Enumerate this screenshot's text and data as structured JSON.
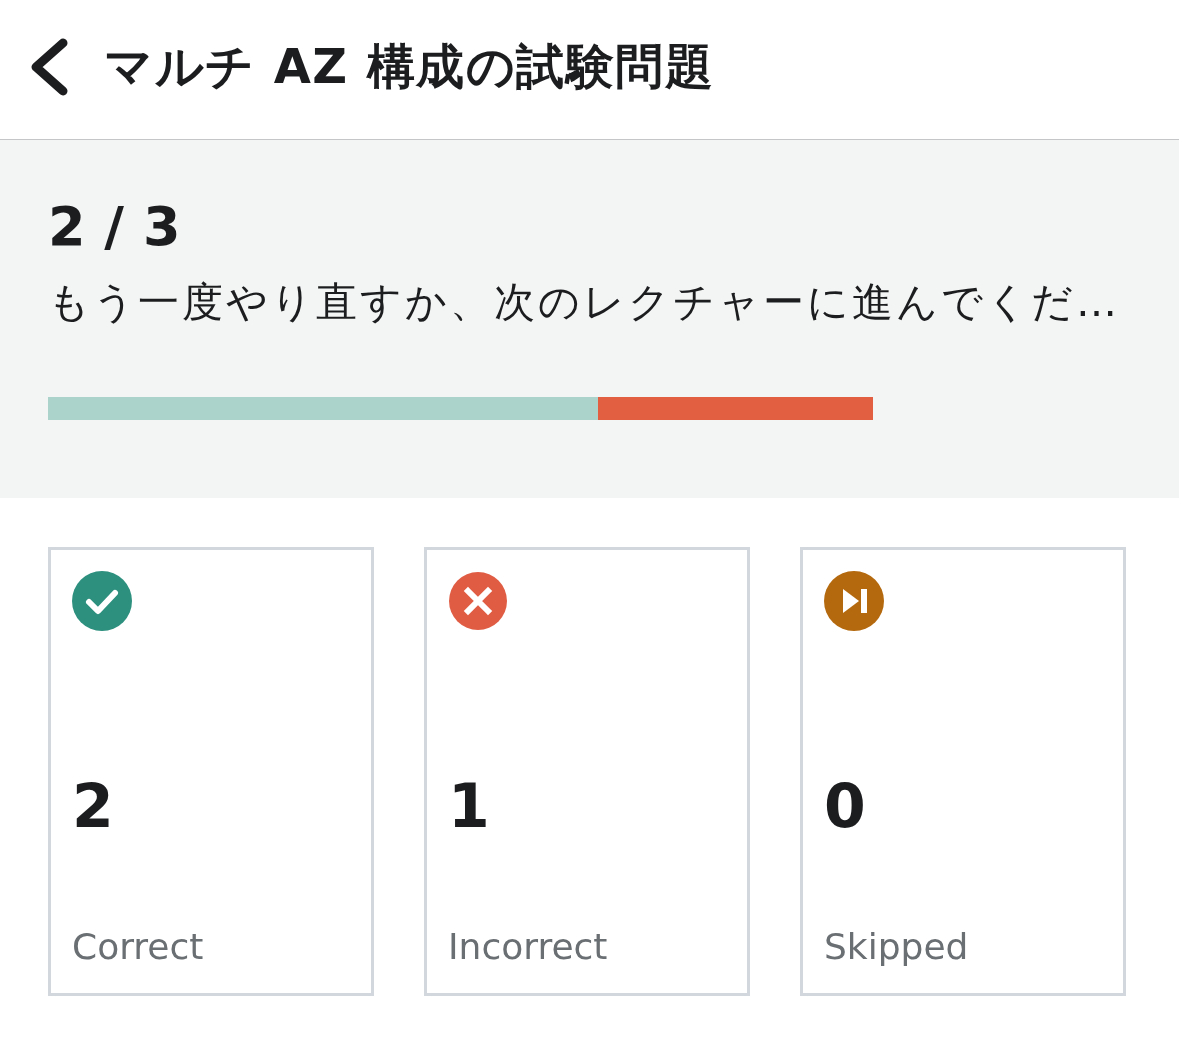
{
  "header": {
    "title": "マルチ AZ 構成の試験問題"
  },
  "summary": {
    "score": "2 / 3",
    "message": "もう一度やり直すか、次のレクチャーに進んでくだ…",
    "progress": [
      {
        "level": 0.6667,
        "color": "#acd2cc"
      },
      {
        "level": 0.3333,
        "color": "#e35f41"
      }
    ]
  },
  "stats": [
    {
      "kind": "correct",
      "count": "2",
      "label": "Correct"
    },
    {
      "kind": "incorrect",
      "count": "1",
      "label": "Incorrect"
    },
    {
      "kind": "skipped",
      "count": "0",
      "label": "Skipped"
    }
  ]
}
